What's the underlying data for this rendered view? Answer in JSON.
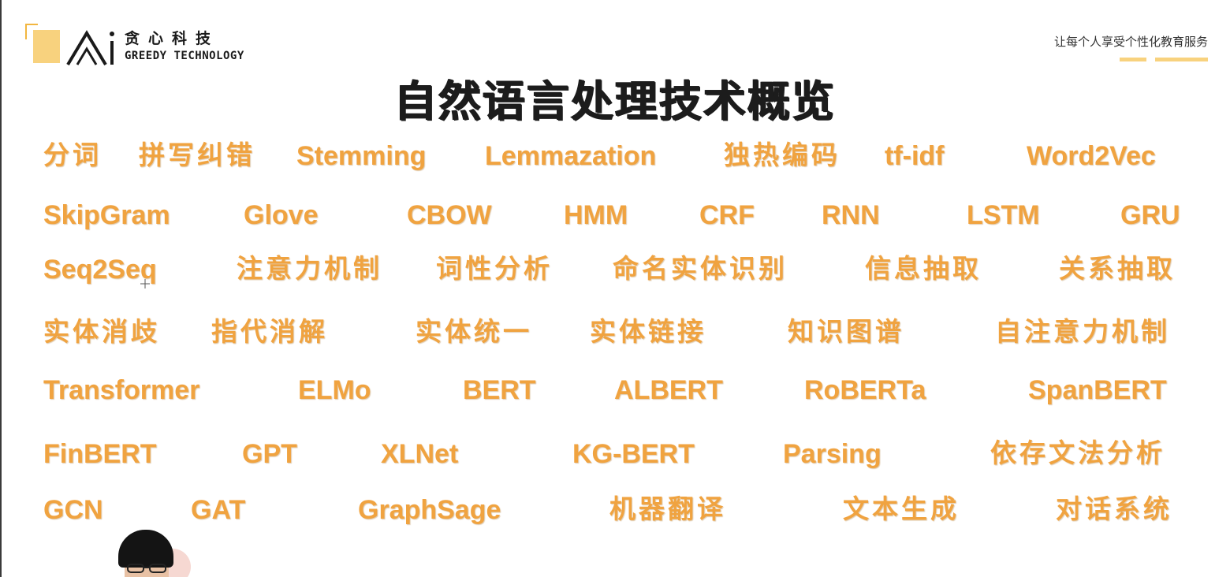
{
  "logo": {
    "cn": "贪心科技",
    "en": "GREEDY TECHNOLOGY"
  },
  "slogan": "让每个人享受个性化教育服务",
  "title": "自然语言处理技术概览",
  "terms": {
    "r1": [
      "分词",
      "拼写纠错",
      "Stemming",
      "Lemmazation",
      "独热编码",
      "tf-idf",
      "Word2Vec"
    ],
    "r2": [
      "SkipGram",
      "Glove",
      "CBOW",
      "HMM",
      "CRF",
      "RNN",
      "LSTM",
      "GRU"
    ],
    "r3": [
      "Seq2Seq",
      "注意力机制",
      "词性分析",
      "命名实体识别",
      "信息抽取",
      "关系抽取"
    ],
    "r4": [
      "实体消歧",
      "指代消解",
      "实体统一",
      "实体链接",
      "知识图谱",
      "自注意力机制"
    ],
    "r5": [
      "Transformer",
      "ELMo",
      "BERT",
      "ALBERT",
      "RoBERTa",
      "SpanBERT"
    ],
    "r6": [
      "FinBERT",
      "GPT",
      "XLNet",
      "KG-BERT",
      "Parsing",
      "依存文法分析"
    ],
    "r7": [
      "GCN",
      "GAT",
      "GraphSage",
      "机器翻译",
      "文本生成",
      "对话系统"
    ]
  },
  "colors": {
    "accent": "#f0a340",
    "logo_yellow": "#f8d27e",
    "title": "#1c1c1c"
  }
}
